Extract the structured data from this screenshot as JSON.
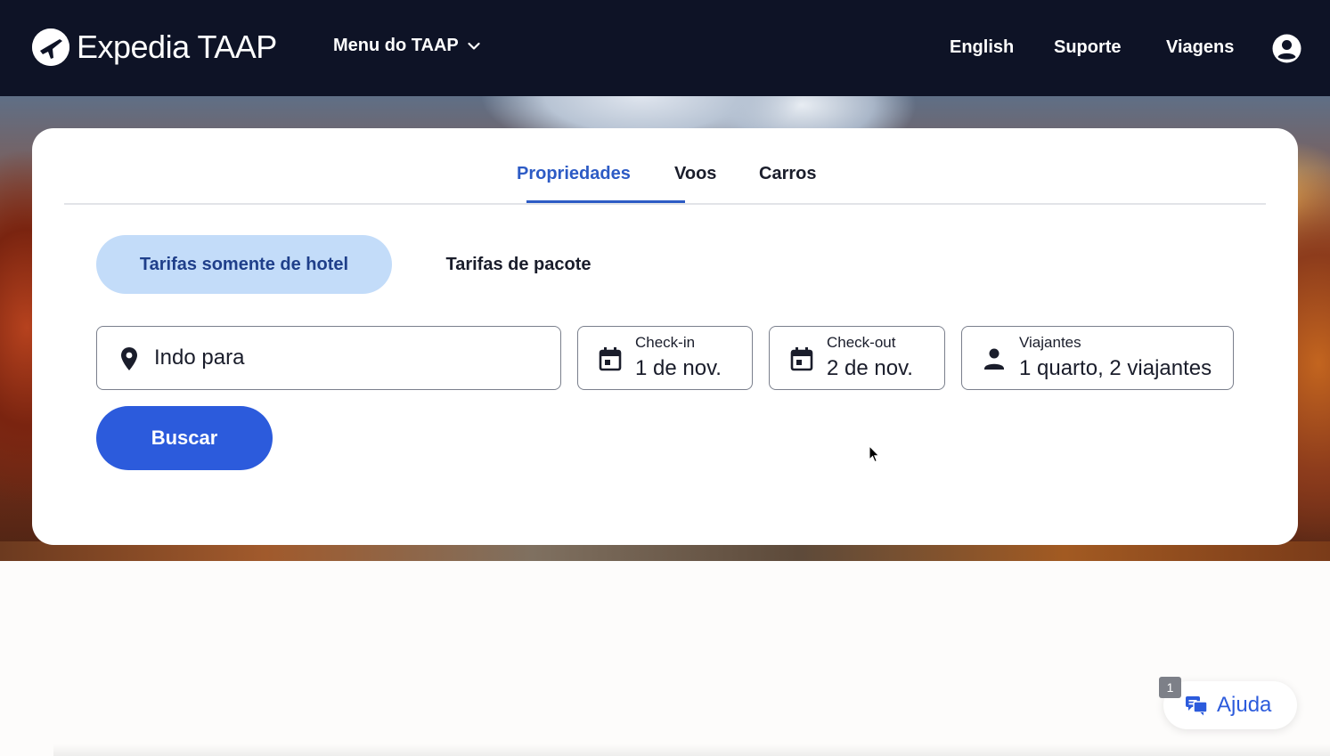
{
  "header": {
    "logo_text": "Expedia TAAP",
    "menu_label": "Menu do TAAP",
    "language": "English",
    "support": "Suporte",
    "trips": "Viagens"
  },
  "search": {
    "tabs": [
      {
        "label": "Propriedades",
        "active": true
      },
      {
        "label": "Voos",
        "active": false
      },
      {
        "label": "Carros",
        "active": false
      }
    ],
    "rate_options": [
      {
        "label": "Tarifas somente de hotel",
        "active": true
      },
      {
        "label": "Tarifas de pacote",
        "active": false
      }
    ],
    "destination": {
      "placeholder": "Indo para"
    },
    "checkin": {
      "label": "Check-in",
      "value": "1 de nov."
    },
    "checkout": {
      "label": "Check-out",
      "value": "2 de nov."
    },
    "travelers": {
      "label": "Viajantes",
      "value": "1 quarto, 2 viajantes"
    },
    "submit_label": "Buscar"
  },
  "help": {
    "label": "Ajuda",
    "badge": "1"
  },
  "colors": {
    "header_bg": "#0e1326",
    "accent": "#2c5bdc",
    "active_tab": "#2d5bc5",
    "pill_active_bg": "#c3dcf9"
  }
}
